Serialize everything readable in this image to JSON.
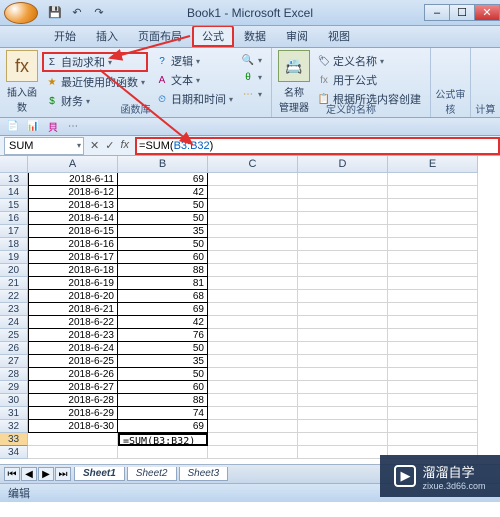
{
  "title": "Book1 - Microsoft Excel",
  "tabs": {
    "t0": "开始",
    "t1": "插入",
    "t2": "页面布局",
    "t3": "公式",
    "t4": "数据",
    "t5": "审阅",
    "t6": "视图"
  },
  "ribbon": {
    "insert_fn": "插入函数",
    "autosum": "自动求和",
    "recent": "最近使用的函数",
    "financial": "财务",
    "logical": "逻辑",
    "text": "文本",
    "datetime": "日期和时间",
    "group_fnlib": "函数库",
    "name_mgr": "名称\n管理器",
    "define_name": "定义名称",
    "use_in_formula": "用于公式",
    "create_from_sel": "根据所选内容创建",
    "group_names": "定义的名称",
    "formula_audit": "公式审核",
    "calculation": "计算"
  },
  "name_box": "SUM",
  "formula": {
    "fn": "SUM",
    "ref": "B3:B32",
    "display": "=SUM(B3:B32)"
  },
  "columns": [
    "A",
    "B",
    "C",
    "D",
    "E"
  ],
  "rows": [
    {
      "n": 13,
      "a": "2018-6-11",
      "b": "69"
    },
    {
      "n": 14,
      "a": "2018-6-12",
      "b": "42"
    },
    {
      "n": 15,
      "a": "2018-6-13",
      "b": "50"
    },
    {
      "n": 16,
      "a": "2018-6-14",
      "b": "50"
    },
    {
      "n": 17,
      "a": "2018-6-15",
      "b": "35"
    },
    {
      "n": 18,
      "a": "2018-6-16",
      "b": "50"
    },
    {
      "n": 19,
      "a": "2018-6-17",
      "b": "60"
    },
    {
      "n": 20,
      "a": "2018-6-18",
      "b": "88"
    },
    {
      "n": 21,
      "a": "2018-6-19",
      "b": "81"
    },
    {
      "n": 22,
      "a": "2018-6-20",
      "b": "68"
    },
    {
      "n": 23,
      "a": "2018-6-21",
      "b": "69"
    },
    {
      "n": 24,
      "a": "2018-6-22",
      "b": "42"
    },
    {
      "n": 25,
      "a": "2018-6-23",
      "b": "76"
    },
    {
      "n": 26,
      "a": "2018-6-24",
      "b": "50"
    },
    {
      "n": 27,
      "a": "2018-6-25",
      "b": "35"
    },
    {
      "n": 28,
      "a": "2018-6-26",
      "b": "50"
    },
    {
      "n": 29,
      "a": "2018-6-27",
      "b": "60"
    },
    {
      "n": 30,
      "a": "2018-6-28",
      "b": "88"
    },
    {
      "n": 31,
      "a": "2018-6-29",
      "b": "74"
    },
    {
      "n": 32,
      "a": "2018-6-30",
      "b": "69"
    },
    {
      "n": 33,
      "a": "",
      "b": "=SUM(B3:B32)",
      "active": true
    },
    {
      "n": 34,
      "a": "",
      "b": ""
    }
  ],
  "sheets": {
    "s1": "Sheet1",
    "s2": "Sheet2",
    "s3": "Sheet3"
  },
  "status": "编辑",
  "watermark": {
    "brand": "溜溜自学",
    "url": "zixue.3d66.com"
  }
}
